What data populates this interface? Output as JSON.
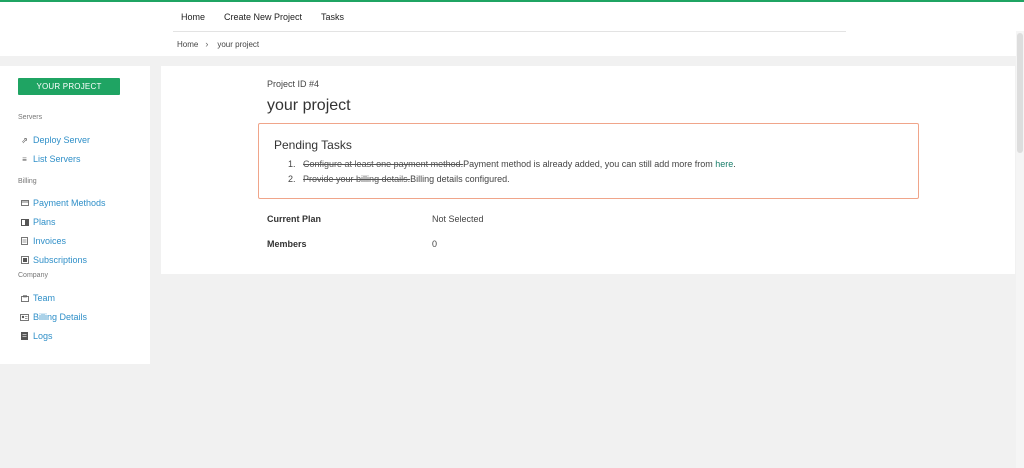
{
  "nav": {
    "items": [
      "Home",
      "Create New Project",
      "Tasks"
    ]
  },
  "breadcrumb": {
    "home": "Home",
    "sep": "›",
    "current": "your project"
  },
  "sidebar": {
    "project_button": "YOUR PROJECT",
    "sections": {
      "servers": "Servers",
      "billing": "Billing",
      "company": "Company"
    },
    "items": [
      {
        "label": "Deploy Server",
        "icon": "deploy-icon"
      },
      {
        "label": "List Servers",
        "icon": "list-icon"
      },
      {
        "label": "Payment Methods",
        "icon": "credit-card-icon"
      },
      {
        "label": "Plans",
        "icon": "plans-icon"
      },
      {
        "label": "Invoices",
        "icon": "invoice-icon"
      },
      {
        "label": "Subscriptions",
        "icon": "subscriptions-icon"
      },
      {
        "label": "Team",
        "icon": "team-icon"
      },
      {
        "label": "Billing Details",
        "icon": "id-card-icon"
      },
      {
        "label": "Logs",
        "icon": "logs-icon"
      }
    ]
  },
  "main": {
    "project_id": "Project ID #4",
    "title": "your project",
    "pending": {
      "heading": "Pending Tasks",
      "tasks": [
        {
          "num": "1.",
          "done": "Configure at least one payment method.",
          "status": "Payment method is already added, you can still add more from ",
          "link": "here",
          "end": "."
        },
        {
          "num": "2.",
          "done": "Provide your billing details.",
          "status": "Billing details configured."
        }
      ]
    },
    "info": [
      {
        "label": "Current Plan",
        "value": "Not Selected"
      },
      {
        "label": "Members",
        "value": "0"
      }
    ]
  },
  "colors": {
    "accent": "#1fa463",
    "link": "#2f8fc8",
    "task_border": "#f0a58a"
  }
}
